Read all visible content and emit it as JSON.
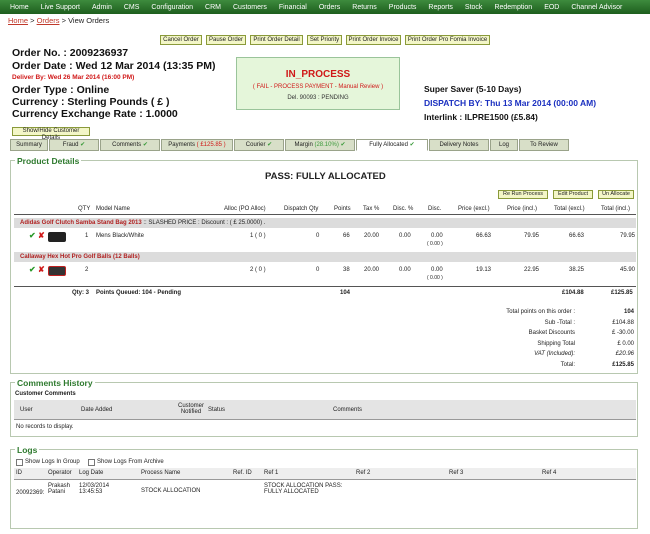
{
  "nav": [
    "Home",
    "Live Support",
    "Admin",
    "CMS",
    "Configuration",
    "CRM",
    "Customers",
    "Financial",
    "Orders",
    "Returns",
    "Products",
    "Reports",
    "Stock",
    "Redemption",
    "EOD",
    "Channel Advisor"
  ],
  "breadcrumb": {
    "home": "Home",
    "sep1": " > ",
    "orders": "Orders",
    "sep2": " > ",
    "current": "View Orders"
  },
  "actions": [
    "Cancel Order",
    "Pause Order",
    "Print Order Detail",
    "Set Priority",
    "Print Order Invoice",
    "Print Order Pro Fomia Invoice"
  ],
  "order": {
    "number": "Order No.   : 2009236937",
    "date": "Order Date : Wed 12 Mar 2014 (13:35 PM)",
    "deliver": "Deliver By: Wed 26 Mar 2014 (16:00 PM)",
    "type": "Order Type : Online",
    "currency": "Currency   : Sterling Pounds ( £ )",
    "rate": "Currency Exchange Rate   : 1.0000"
  },
  "status": {
    "title": "IN_PROCESS",
    "detail": "( FAIL - PROCESS PAYMENT - Manual Review )",
    "del": "Del. 90093 : PENDING"
  },
  "shipping": {
    "method": "Super Saver (5-10 Days)",
    "dispatch": "DISPATCH BY: Thu 13 Mar 2014 (00:00 AM)",
    "interlink": "Interlink : ILPRE1500 (£5.84)"
  },
  "toggle_label": "Show/Hide Customer Details",
  "tabs": [
    {
      "label": "Summary",
      "mark": ""
    },
    {
      "label": "Fraud",
      "mark": "✔"
    },
    {
      "label": "Comments",
      "mark": "✔"
    },
    {
      "label": "Payments",
      "extra": "( £125.85 )",
      "mark": ""
    },
    {
      "label": "Courier",
      "mark": "✔"
    },
    {
      "label": "Margin",
      "extra": "(28.10%)",
      "mark": "✔"
    },
    {
      "label": "Fully Allocated",
      "mark": "✔"
    },
    {
      "label": "Delivery Notes",
      "mark": ""
    },
    {
      "label": "Log",
      "mark": ""
    },
    {
      "label": "To Review",
      "mark": ""
    }
  ],
  "product": {
    "title": "Product Details",
    "pass": "PASS: FULLY ALLOCATED",
    "buttons": [
      "Re Run Process",
      "Edit Product",
      "Un Allocate"
    ],
    "headers": [
      "QTY",
      "Model Name",
      "Alloc (PO Alloc)",
      "Dispatch Qty",
      "Points",
      "Tax %",
      "Disc. %",
      "Disc.",
      "Price (excl.)",
      "Price (incl.)",
      "Total (excl.)",
      "Total (incl.)"
    ],
    "items": [
      {
        "name": "Adidas Golf Clutch Samba Stand Bag 2013",
        "note": " :: SLASHED PRICE : Discount : ( £ 25.0000) .",
        "qty": "1",
        "model": "Mens Black/White",
        "alloc": "1 ( 0 )",
        "dispatch": "0",
        "points": "66",
        "tax": "20.00",
        "discp": "0.00",
        "disc": "0.00",
        "disc2": "( 0.00 )",
        "pex": "66.63",
        "pin": "79.95",
        "tex": "66.63",
        "tin": "79.95"
      },
      {
        "name": "Callaway Hex Hot Pro Golf Balls (12 Balls)",
        "note": "",
        "qty": "2",
        "model": "",
        "alloc": "2 ( 0 )",
        "dispatch": "0",
        "points": "38",
        "tax": "20.00",
        "discp": "0.00",
        "disc": "0.00",
        "disc2": "( 0.00 )",
        "pex": "19.13",
        "pin": "22.95",
        "tex": "38.25",
        "tin": "45.90"
      }
    ],
    "summary": {
      "qty": "Qty: 3",
      "queued": "Points Queued: 104 - Pending",
      "points": "104",
      "tex": "£104.88",
      "tin": "£125.85"
    },
    "totals": [
      {
        "label": "Total points on this order :",
        "value": "104"
      },
      {
        "label": "Sub -Total :",
        "value": "£104.88"
      },
      {
        "label": "Basket Discounts",
        "value": "£ -30.00"
      },
      {
        "label": "Shipping Total",
        "value": "£ 0.00"
      },
      {
        "label": "VAT (Included):",
        "value": "£20.96"
      },
      {
        "label": "Total:",
        "value": "£125.85"
      }
    ]
  },
  "comments": {
    "title": "Comments History",
    "sub": "Customer Comments",
    "headers": [
      "User",
      "Date Added",
      "Customer Notified",
      "Status",
      "Comments"
    ],
    "empty": "No records to display."
  },
  "logs": {
    "title": "Logs",
    "check1": "Show Logs In Group",
    "check2": "Show Logs From Archive",
    "headers": [
      "ID",
      "Operator",
      "Log Date",
      "Process Name",
      "Ref. ID",
      "Ref 1",
      "Ref 2",
      "Ref 3",
      "Ref 4"
    ],
    "row": {
      "id": "20092369:",
      "operator": "Prakash Patani",
      "date": "12/03/2014 13:45:53",
      "process": "STOCK ALLOCATION",
      "refid": "",
      "ref1": "STOCK ALLOCATION PASS: FULLY ALLOCATED"
    }
  }
}
